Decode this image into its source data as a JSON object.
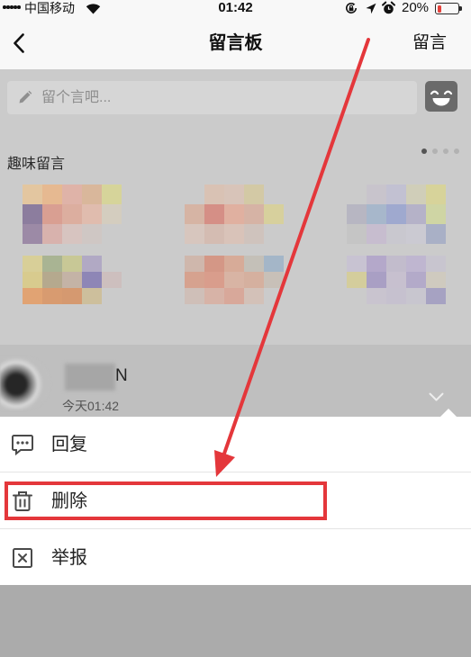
{
  "status_bar": {
    "carrier": "中国移动",
    "signal_level": 5,
    "signal_max": 5,
    "time": "01:42",
    "battery_percent": "20%",
    "battery_level": 0.2,
    "battery_fill_color": "#e5413b"
  },
  "nav": {
    "title": "留言板",
    "action_label": "留言"
  },
  "composer": {
    "placeholder": "留个言吧...",
    "icons": [
      "pencil-icon",
      "emoji-face-icon"
    ]
  },
  "fun_messages": {
    "heading": "趣味留言",
    "page_count": 4,
    "active_page": 1,
    "stickers": [
      {
        "palette": [
          "#e3c6a0",
          "#e6b991",
          "#dfb3a8",
          "#d9b79b",
          "#d6d49a",
          "#8c7d9e",
          "#d99f92",
          "#dcae9f",
          "#e0bcae",
          "#d4cdbf",
          "#9c8aa6",
          "#d8b2ad",
          "#d7c4c0",
          "#cfc7c4",
          "#cbcbcb"
        ]
      },
      {
        "palette": [
          "#cbcbcb",
          "#d9c2b4",
          "#d8c4b9",
          "#d3c9a5",
          "#cbcbcb",
          "#d6b4a4",
          "#d58f86",
          "#e0b0a0",
          "#d6b3a5",
          "#d7d09d",
          "#d7c6be",
          "#d4bcb2",
          "#d9c3b9",
          "#cfc3bd",
          "#cbcbcb"
        ]
      },
      {
        "palette": [
          "#cbcbcb",
          "#c8c4cc",
          "#c2c1d2",
          "#d0ceb9",
          "#d7d39a",
          "#b7b6c2",
          "#a7b7cb",
          "#9fa9cf",
          "#b5b2c8",
          "#cfd5a4",
          "#c5c5c5",
          "#c7bdcf",
          "#c9c8cf",
          "#cbcad2",
          "#a9b0c6"
        ]
      },
      {
        "palette": [
          "#d8cf98",
          "#a9b493",
          "#c8c896",
          "#b1a9c4",
          "#cbcbcb",
          "#d8cb8e",
          "#b5a98e",
          "#c4b3a6",
          "#8e86b6",
          "#cdbfbe",
          "#e1a373",
          "#d89b70",
          "#d59970",
          "#cdbf9c",
          "#cbcbcb"
        ]
      },
      {
        "palette": [
          "#cfb7ac",
          "#d49786",
          "#d7ab98",
          "#c4c0b8",
          "#a4b6c8",
          "#d6a28f",
          "#d99d8c",
          "#d8b4a4",
          "#d5b09f",
          "#c8c0b8",
          "#cfbfb8",
          "#d7b3a7",
          "#d8a89a",
          "#d3c1b8",
          "#cbcbcb"
        ]
      },
      {
        "palette": [
          "#c8c3d2",
          "#b4a8ca",
          "#c2bccc",
          "#bfb6d0",
          "#c8c5cf",
          "#d4cd9c",
          "#a99fc4",
          "#c7c0cf",
          "#b3aac9",
          "#cfcabf",
          "#cbcbcb",
          "#c9c4cf",
          "#c6c1cf",
          "#c8c6cf",
          "#a6a2c2"
        ]
      }
    ]
  },
  "message": {
    "author_visible": "N",
    "time": "今天01:42"
  },
  "action_sheet": {
    "items": [
      {
        "label": "回复",
        "icon": "reply-bubble-icon"
      },
      {
        "label": "删除",
        "icon": "trash-icon",
        "highlighted": true
      },
      {
        "label": "举报",
        "icon": "report-icon"
      }
    ]
  },
  "annotation": {
    "color": "#e4373b"
  }
}
